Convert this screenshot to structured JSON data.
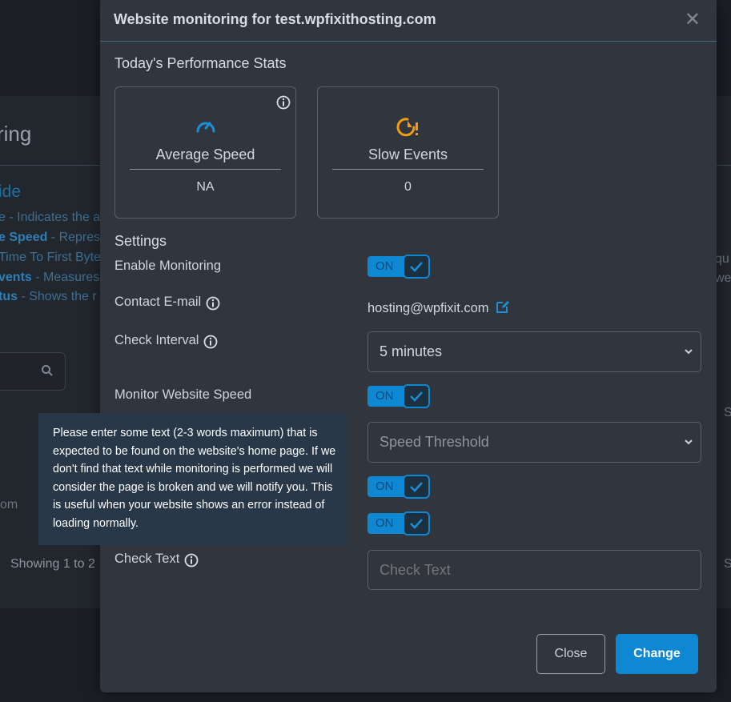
{
  "background": {
    "title_fragment": "ring",
    "guide_fragment": "ide",
    "lines": [
      {
        "bold": "",
        "text": "e - Indicates the a"
      },
      {
        "bold": "e Speed",
        "text": " - Repres"
      },
      {
        "bold": "",
        "text": "Time To First Byte"
      },
      {
        "bold": "vents",
        "text": " - Measures"
      },
      {
        "bold": "tus",
        "text": " - Shows the r"
      }
    ],
    "right_fragments": [
      "qu",
      "we"
    ],
    "showing_text": "Showing 1 to 2",
    "om_text": "om",
    "s_text": "S"
  },
  "modal": {
    "title": "Website monitoring for test.wpfixithosting.com",
    "close_symbol": "✕",
    "stats_heading": "Today's Performance Stats",
    "stats": [
      {
        "label": "Average Speed",
        "value": "NA",
        "icon": "speedometer-icon",
        "color": "#1b8ed6"
      },
      {
        "label": "Slow Events",
        "value": "0",
        "icon": "slow-clock-alert-icon",
        "color": "#f39c12"
      }
    ],
    "settings_heading": "Settings",
    "settings": {
      "enable_monitoring": {
        "label": "Enable Monitoring",
        "toggle": "ON"
      },
      "contact_email": {
        "label": "Contact E-mail",
        "value": "hosting@wpfixit.com"
      },
      "check_interval": {
        "label": "Check Interval",
        "value": "5 minutes"
      },
      "monitor_speed": {
        "label": "Monitor Website Speed",
        "toggle": "ON"
      },
      "speed_threshold": {
        "placeholder": "Speed Threshold"
      },
      "toggle_3": "ON",
      "toggle_4": "ON",
      "check_text": {
        "label": "Check Text",
        "placeholder": "Check Text"
      }
    },
    "buttons": {
      "close": "Close",
      "change": "Change"
    }
  },
  "tooltip": {
    "text": "Please enter some text (2-3 words maximum) that is expected to be found on the website's home page. If we don't find that text while monitoring is performed we will consider the page is broken and we will notify you. This is useful when your website shows an error instead of loading normally."
  },
  "colors": {
    "accent": "#0e88d2",
    "modal_bg": "#31363e",
    "tooltip_bg": "#283848"
  }
}
